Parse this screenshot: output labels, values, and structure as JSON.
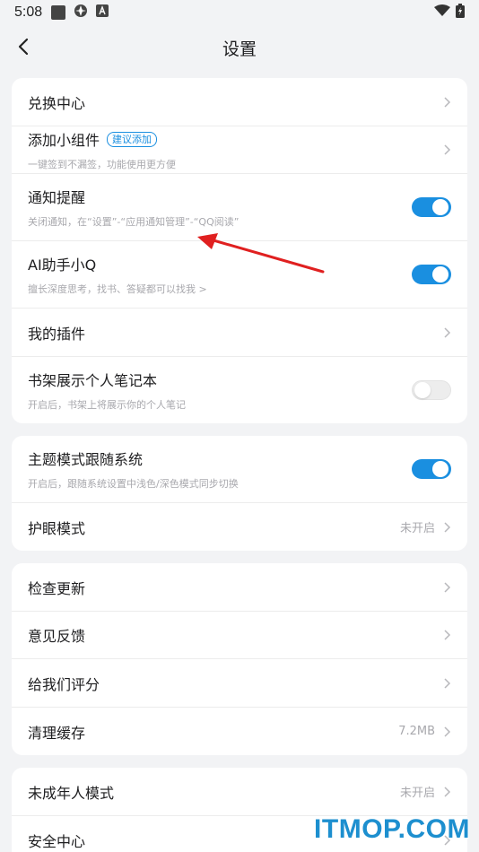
{
  "status": {
    "time": "5:08"
  },
  "header": {
    "title": "设置"
  },
  "groups": [
    {
      "items": [
        {
          "label": "兑换中心"
        },
        {
          "label": "添加小组件",
          "tag": "建议添加",
          "sub": "一键签到不漏签，功能使用更方便"
        },
        {
          "label": "通知提醒",
          "sub": "关闭通知，在“设置”-“应用通知管理”-“QQ阅读”",
          "toggle": "on"
        },
        {
          "label": "AI助手小Q",
          "sub": "擅长深度思考，找书、答疑都可以找我 >",
          "toggle": "on"
        },
        {
          "label": "我的插件"
        },
        {
          "label": "书架展示个人笔记本",
          "sub": "开启后，书架上将展示你的个人笔记",
          "toggle": "off"
        }
      ]
    },
    {
      "items": [
        {
          "label": "主题模式跟随系统",
          "sub": "开启后，跟随系统设置中浅色/深色模式同步切换",
          "toggle": "on"
        },
        {
          "label": "护眼模式",
          "value": "未开启"
        }
      ]
    },
    {
      "items": [
        {
          "label": "检查更新"
        },
        {
          "label": "意见反馈"
        },
        {
          "label": "给我们评分"
        },
        {
          "label": "清理缓存",
          "value": "7.2MB"
        }
      ]
    },
    {
      "items": [
        {
          "label": "未成年人模式",
          "value": "未开启"
        },
        {
          "label": "安全中心"
        }
      ]
    }
  ],
  "colors": {
    "accent": "#1a8fe0",
    "annotation_arrow": "#e02020",
    "watermark": "#1d8fcf"
  },
  "watermark": "ITMOP.COM"
}
